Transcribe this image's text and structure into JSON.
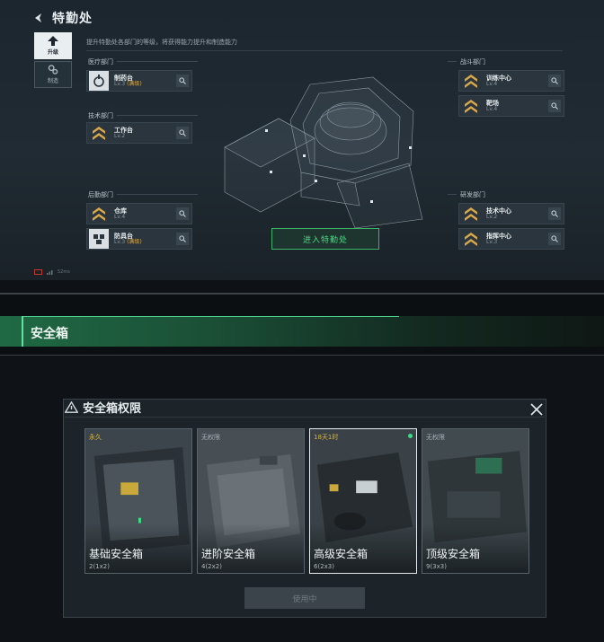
{
  "header": {
    "title": "特勤处"
  },
  "hint": "提升特勤处各部门的等级，将获得能力提升和制造能力",
  "side_tabs": [
    {
      "label": "升级",
      "icon": "upgrade-icon",
      "active": true
    },
    {
      "label": "制造",
      "icon": "gears-icon",
      "active": false
    }
  ],
  "departments": {
    "medical": {
      "label": "医疗部门",
      "items": [
        {
          "name": "制药台",
          "level": "Lv.3",
          "max": "(满级)",
          "icon": "pharmacy-icon"
        }
      ]
    },
    "tech": {
      "label": "技术部门",
      "items": [
        {
          "name": "工作台",
          "level": "Lv.2",
          "max": "",
          "icon": "chevron-rank-icon"
        }
      ]
    },
    "logistics": {
      "label": "后勤部门",
      "items": [
        {
          "name": "仓库",
          "level": "Lv.4",
          "max": "",
          "icon": "chevron-rank-icon"
        },
        {
          "name": "防具台",
          "level": "Lv.3",
          "max": "(满级)",
          "icon": "armor-icon"
        }
      ]
    },
    "combat": {
      "label": "战斗部门",
      "items": [
        {
          "name": "训练中心",
          "level": "Lv.4",
          "max": "",
          "icon": "chevron-rank-icon"
        },
        {
          "name": "靶场",
          "level": "Lv.4",
          "max": "",
          "icon": "chevron-rank-icon"
        }
      ]
    },
    "research": {
      "label": "研发部门",
      "items": [
        {
          "name": "技术中心",
          "level": "Lv.2",
          "max": "",
          "icon": "chevron-rank-icon"
        },
        {
          "name": "指挥中心",
          "level": "Lv.3",
          "max": "",
          "icon": "chevron-rank-icon"
        }
      ]
    }
  },
  "enter_button": "进入特勤处",
  "status_text": "52ms",
  "banner": {
    "title": "安全箱"
  },
  "dialog": {
    "title": "安全箱权限",
    "cards": [
      {
        "tag": "永久",
        "name": "基础安全箱",
        "size": "2(1x2)",
        "tag_color": "#d8b443",
        "selected": false,
        "active_dot": false
      },
      {
        "tag": "无权限",
        "name": "进阶安全箱",
        "size": "4(2x2)",
        "tag_color": "#a5afb5",
        "selected": false,
        "active_dot": false
      },
      {
        "tag": "18天1时",
        "name": "高级安全箱",
        "size": "6(2x3)",
        "tag_color": "#d8b443",
        "selected": true,
        "active_dot": true
      },
      {
        "tag": "无权限",
        "name": "顶级安全箱",
        "size": "9(3x3)",
        "tag_color": "#a5afb5",
        "selected": false,
        "active_dot": false
      }
    ],
    "use_button": "使用中"
  },
  "colors": {
    "accent_green": "#48d882",
    "level_max": "#d9a84a",
    "banner_green": "#1f6a44"
  }
}
